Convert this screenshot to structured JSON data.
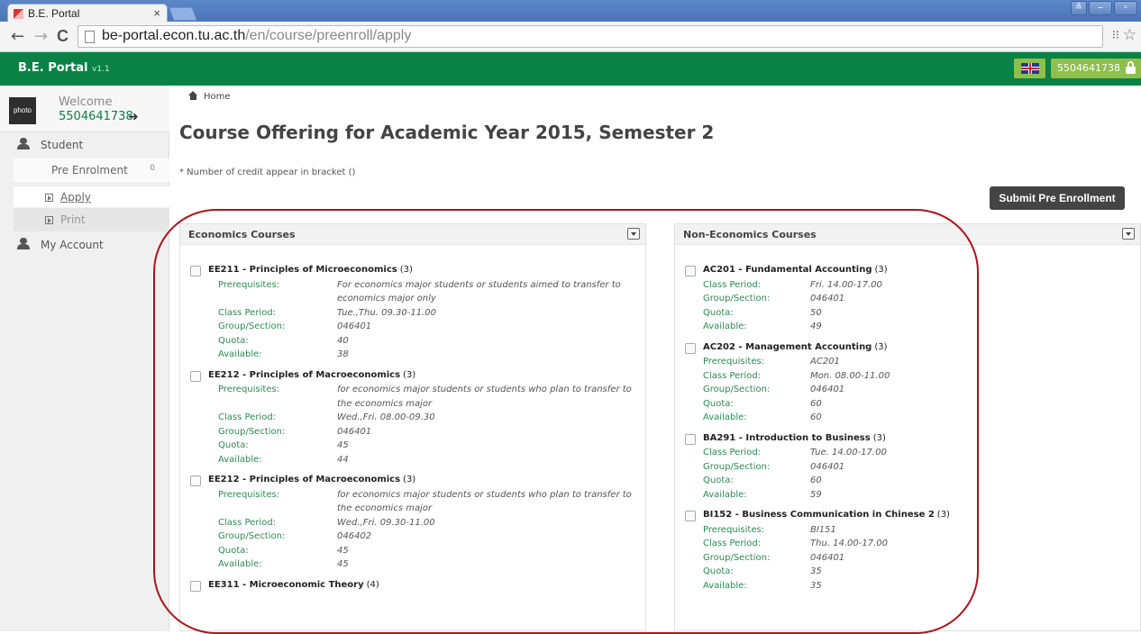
{
  "browser": {
    "tab_title": "B.E. Portal",
    "tab_close": "×",
    "url_host": "be-portal.econ.tu.ac.th",
    "url_path": "/en/course/preenroll/apply",
    "back": "←",
    "forward": "→",
    "reload": "C",
    "star": "☆",
    "ext": "⁝⁝",
    "window_buttons": [
      "≗",
      "–",
      "▫"
    ]
  },
  "header": {
    "brand": "B.E. Portal",
    "version": "v1.1",
    "user_id": "5504641738"
  },
  "sidebar": {
    "photo_label": "photo",
    "welcome": "Welcome",
    "user_id": "5504641738",
    "arrow": "➜",
    "student": "Student",
    "pre_enrolment": "Pre Enrolment",
    "pre_enrolment_count": "0",
    "apply": "Apply",
    "print": "Print",
    "my_account": "My Account"
  },
  "main": {
    "breadcrumb": "Home",
    "title": "Course Offering for Academic Year 2015, Semester 2",
    "note": "* Number of credit appear in bracket ()",
    "submit": "Submit Pre Enrollment"
  },
  "labels": {
    "prereq": "Prerequisites:",
    "period": "Class Period:",
    "group": "Group/Section:",
    "quota": "Quota:",
    "available": "Available:"
  },
  "economics": {
    "title": "Economics Courses",
    "courses": [
      {
        "code": "EE211 - Principles of Microeconomics",
        "credit": "(3)",
        "prereq": [
          "For economics major students or students aimed to transfer to",
          "economics major only"
        ],
        "period": "Tue.,Thu. 09.30-11.00",
        "group": "046401",
        "quota": "40",
        "available": "38"
      },
      {
        "code": "EE212 - Principles of Macroeconomics",
        "credit": "(3)",
        "prereq": [
          "for economics major students or students who plan to transfer to",
          "the economics major"
        ],
        "period": "Wed.,Fri. 08.00-09.30",
        "group": "046401",
        "quota": "45",
        "available": "44"
      },
      {
        "code": "EE212 - Principles of Macroeconomics",
        "credit": "(3)",
        "prereq": [
          "for economics major students or students who plan to transfer to",
          "the economics major"
        ],
        "period": "Wed.,Fri. 09.30-11.00",
        "group": "046402",
        "quota": "45",
        "available": "45"
      },
      {
        "code": "EE311 - Microeconomic Theory",
        "credit": "(4)"
      }
    ]
  },
  "non_economics": {
    "title": "Non-Economics Courses",
    "courses": [
      {
        "code": "AC201 - Fundamental Accounting",
        "credit": "(3)",
        "period": "Fri. 14.00-17.00",
        "group": "046401",
        "quota": "50",
        "available": "49"
      },
      {
        "code": "AC202 - Management Accounting",
        "credit": "(3)",
        "prereq": "AC201",
        "period": "Mon. 08.00-11.00",
        "group": "046401",
        "quota": "60",
        "available": "60"
      },
      {
        "code": "BA291 - Introduction to Business",
        "credit": "(3)",
        "period": "Tue. 14.00-17.00",
        "group": "046401",
        "quota": "60",
        "available": "59"
      },
      {
        "code": "BI152 - Business Communication in Chinese 2",
        "credit": "(3)",
        "prereq": "BI151",
        "period": "Thu. 14.00-17.00",
        "group": "046401",
        "quota": "35",
        "available": "35"
      }
    ]
  },
  "colors": {
    "brand_green": "#0a8245",
    "label_green": "#2e8a52",
    "accent_lime": "#8fbf4d",
    "annotation_red": "#b0121b"
  }
}
